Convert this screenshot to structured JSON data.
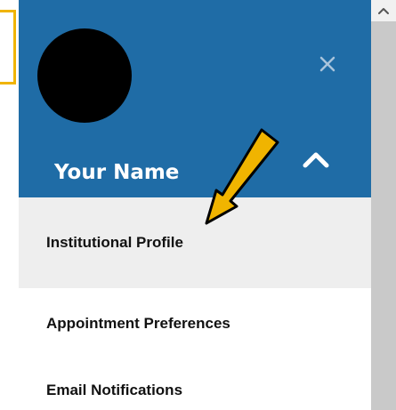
{
  "profile_panel": {
    "user_name": "Your Name",
    "menu": {
      "items": [
        {
          "label": "Institutional Profile",
          "active": true
        },
        {
          "label": "Appointment Preferences",
          "active": false
        },
        {
          "label": "Email Notifications",
          "active": false
        }
      ]
    }
  },
  "icons": {
    "close": "close-icon",
    "collapse": "chevron-up-icon",
    "scroll_up": "chevron-up-icon",
    "avatar": "avatar"
  },
  "colors": {
    "header_bg": "#1f6ca6",
    "active_item_bg": "#eeeeee",
    "highlight_outline": "#f0b400",
    "annotation_arrow": "#f0b400"
  }
}
